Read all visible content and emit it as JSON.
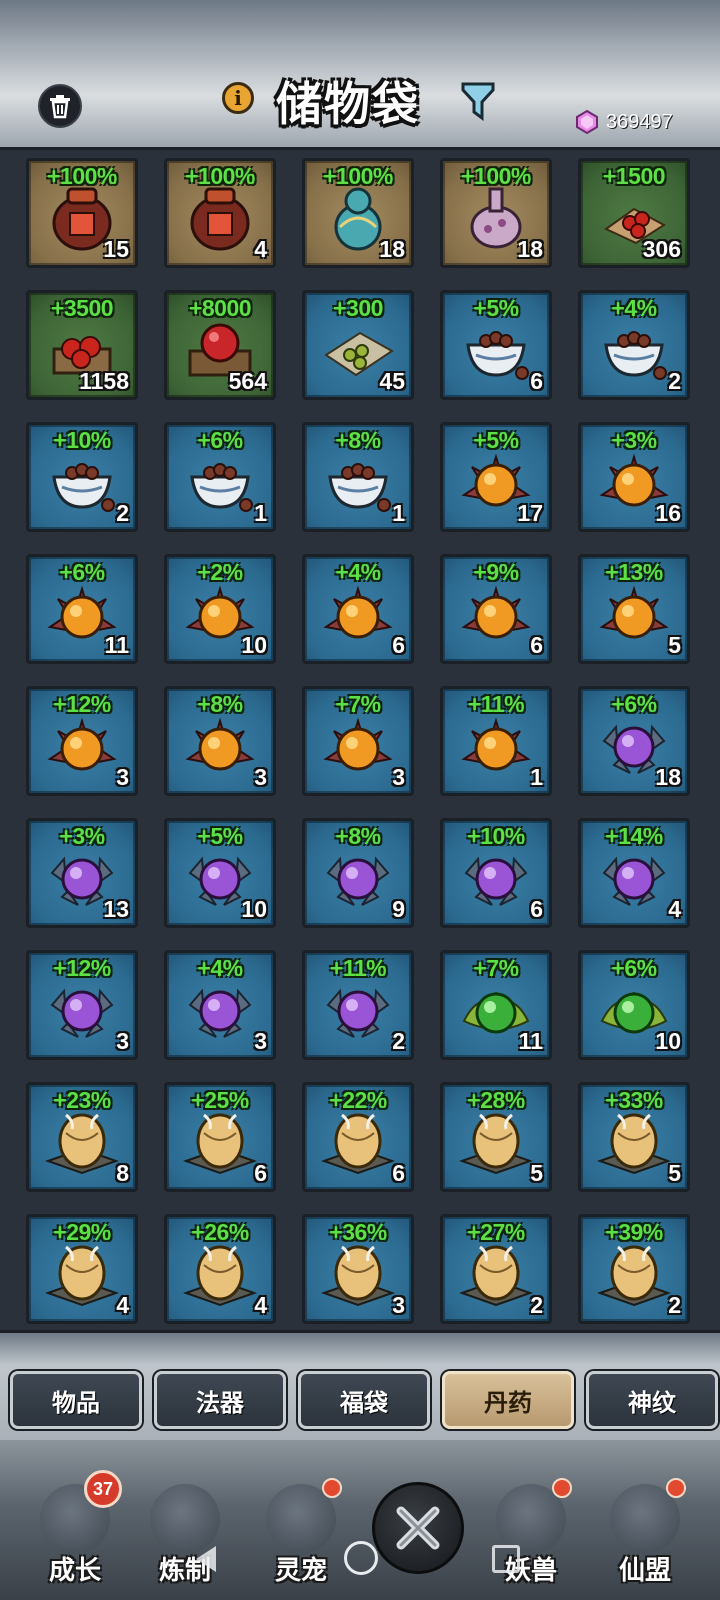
{
  "header": {
    "title": "储物袋",
    "currency_count": "369497",
    "icons": [
      "trash-icon",
      "info-icon",
      "filter-icon",
      "gem-icon"
    ]
  },
  "colors": {
    "bonus_green": "#5de046",
    "tab_active": "#c9ad84",
    "cell_blue": "#2c6a90",
    "cell_brown": "#86704a",
    "cell_green": "#3d6436",
    "badge_red": "#d63a2a"
  },
  "items": [
    {
      "bonus": "+100%",
      "qty": "15",
      "bg": "brown",
      "icon": "wine-jar-icon"
    },
    {
      "bonus": "+100%",
      "qty": "4",
      "bg": "brown",
      "icon": "wine-jar-icon"
    },
    {
      "bonus": "+100%",
      "qty": "18",
      "bg": "brown",
      "icon": "gourd-icon"
    },
    {
      "bonus": "+100%",
      "qty": "18",
      "bg": "brown",
      "icon": "potion-flask-icon"
    },
    {
      "bonus": "+1500",
      "qty": "306",
      "bg": "green",
      "icon": "berries-icon"
    },
    {
      "bonus": "+3500",
      "qty": "1158",
      "bg": "green",
      "icon": "berry-box-icon"
    },
    {
      "bonus": "+8000",
      "qty": "564",
      "bg": "green",
      "icon": "fruit-box-icon"
    },
    {
      "bonus": "+300",
      "qty": "45",
      "bg": "blue",
      "icon": "pill-cloth-icon"
    },
    {
      "bonus": "+5%",
      "qty": "6",
      "bg": "blue",
      "icon": "pill-bowl-icon"
    },
    {
      "bonus": "+4%",
      "qty": "2",
      "bg": "blue",
      "icon": "pill-bowl-icon"
    },
    {
      "bonus": "+10%",
      "qty": "2",
      "bg": "blue",
      "icon": "pill-bowl-icon"
    },
    {
      "bonus": "+6%",
      "qty": "1",
      "bg": "blue",
      "icon": "pill-bowl-icon"
    },
    {
      "bonus": "+8%",
      "qty": "1",
      "bg": "blue",
      "icon": "pill-bowl-icon"
    },
    {
      "bonus": "+5%",
      "qty": "17",
      "bg": "blue",
      "icon": "orange-lotus-pill-icon"
    },
    {
      "bonus": "+3%",
      "qty": "16",
      "bg": "blue",
      "icon": "orange-lotus-pill-icon"
    },
    {
      "bonus": "+6%",
      "qty": "11",
      "bg": "blue",
      "icon": "orange-lotus-pill-icon"
    },
    {
      "bonus": "+2%",
      "qty": "10",
      "bg": "blue",
      "icon": "orange-lotus-pill-icon"
    },
    {
      "bonus": "+4%",
      "qty": "6",
      "bg": "blue",
      "icon": "orange-lotus-pill-icon"
    },
    {
      "bonus": "+9%",
      "qty": "6",
      "bg": "blue",
      "icon": "orange-lotus-pill-icon"
    },
    {
      "bonus": "+13%",
      "qty": "5",
      "bg": "blue",
      "icon": "orange-lotus-pill-icon"
    },
    {
      "bonus": "+12%",
      "qty": "3",
      "bg": "blue",
      "icon": "orange-lotus-pill-icon"
    },
    {
      "bonus": "+8%",
      "qty": "3",
      "bg": "blue",
      "icon": "orange-lotus-pill-icon"
    },
    {
      "bonus": "+7%",
      "qty": "3",
      "bg": "blue",
      "icon": "orange-lotus-pill-icon"
    },
    {
      "bonus": "+11%",
      "qty": "1",
      "bg": "blue",
      "icon": "orange-lotus-pill-icon"
    },
    {
      "bonus": "+6%",
      "qty": "18",
      "bg": "blue",
      "icon": "purple-crystal-pill-icon"
    },
    {
      "bonus": "+3%",
      "qty": "13",
      "bg": "blue",
      "icon": "purple-crystal-pill-icon"
    },
    {
      "bonus": "+5%",
      "qty": "10",
      "bg": "blue",
      "icon": "purple-crystal-pill-icon"
    },
    {
      "bonus": "+8%",
      "qty": "9",
      "bg": "blue",
      "icon": "purple-crystal-pill-icon"
    },
    {
      "bonus": "+10%",
      "qty": "6",
      "bg": "blue",
      "icon": "purple-crystal-pill-icon"
    },
    {
      "bonus": "+14%",
      "qty": "4",
      "bg": "blue",
      "icon": "purple-crystal-pill-icon"
    },
    {
      "bonus": "+12%",
      "qty": "3",
      "bg": "blue",
      "icon": "purple-crystal-pill-icon"
    },
    {
      "bonus": "+4%",
      "qty": "3",
      "bg": "blue",
      "icon": "purple-crystal-pill-icon"
    },
    {
      "bonus": "+11%",
      "qty": "2",
      "bg": "blue",
      "icon": "purple-crystal-pill-icon"
    },
    {
      "bonus": "+7%",
      "qty": "11",
      "bg": "blue",
      "icon": "green-leaf-pill-icon"
    },
    {
      "bonus": "+6%",
      "qty": "10",
      "bg": "blue",
      "icon": "green-leaf-pill-icon"
    },
    {
      "bonus": "+23%",
      "qty": "8",
      "bg": "blue",
      "icon": "golden-egg-icon"
    },
    {
      "bonus": "+25%",
      "qty": "6",
      "bg": "blue",
      "icon": "golden-egg-icon"
    },
    {
      "bonus": "+22%",
      "qty": "6",
      "bg": "blue",
      "icon": "golden-egg-icon"
    },
    {
      "bonus": "+28%",
      "qty": "5",
      "bg": "blue",
      "icon": "golden-egg-icon"
    },
    {
      "bonus": "+33%",
      "qty": "5",
      "bg": "blue",
      "icon": "golden-egg-icon"
    },
    {
      "bonus": "+29%",
      "qty": "4",
      "bg": "blue",
      "icon": "golden-egg-icon"
    },
    {
      "bonus": "+26%",
      "qty": "4",
      "bg": "blue",
      "icon": "golden-egg-icon"
    },
    {
      "bonus": "+36%",
      "qty": "3",
      "bg": "blue",
      "icon": "golden-egg-icon"
    },
    {
      "bonus": "+27%",
      "qty": "2",
      "bg": "blue",
      "icon": "golden-egg-icon"
    },
    {
      "bonus": "+39%",
      "qty": "2",
      "bg": "blue",
      "icon": "golden-egg-icon"
    }
  ],
  "tabs": [
    {
      "label": "物品",
      "active": false
    },
    {
      "label": "法器",
      "active": false
    },
    {
      "label": "福袋",
      "active": false
    },
    {
      "label": "丹药",
      "active": true
    },
    {
      "label": "神纹",
      "active": false
    }
  ],
  "nav": [
    {
      "label": "成长",
      "icon": "growth-icon",
      "badge": "37"
    },
    {
      "label": "炼制",
      "icon": "forge-icon",
      "badge": ""
    },
    {
      "label": "灵宠",
      "icon": "spirit-pet-icon",
      "badge": "dot"
    },
    {
      "label": "妖兽",
      "icon": "demon-beast-icon",
      "badge": "dot"
    },
    {
      "label": "仙盟",
      "icon": "sect-alliance-icon",
      "badge": "dot"
    }
  ],
  "close_icon": "close-icon"
}
